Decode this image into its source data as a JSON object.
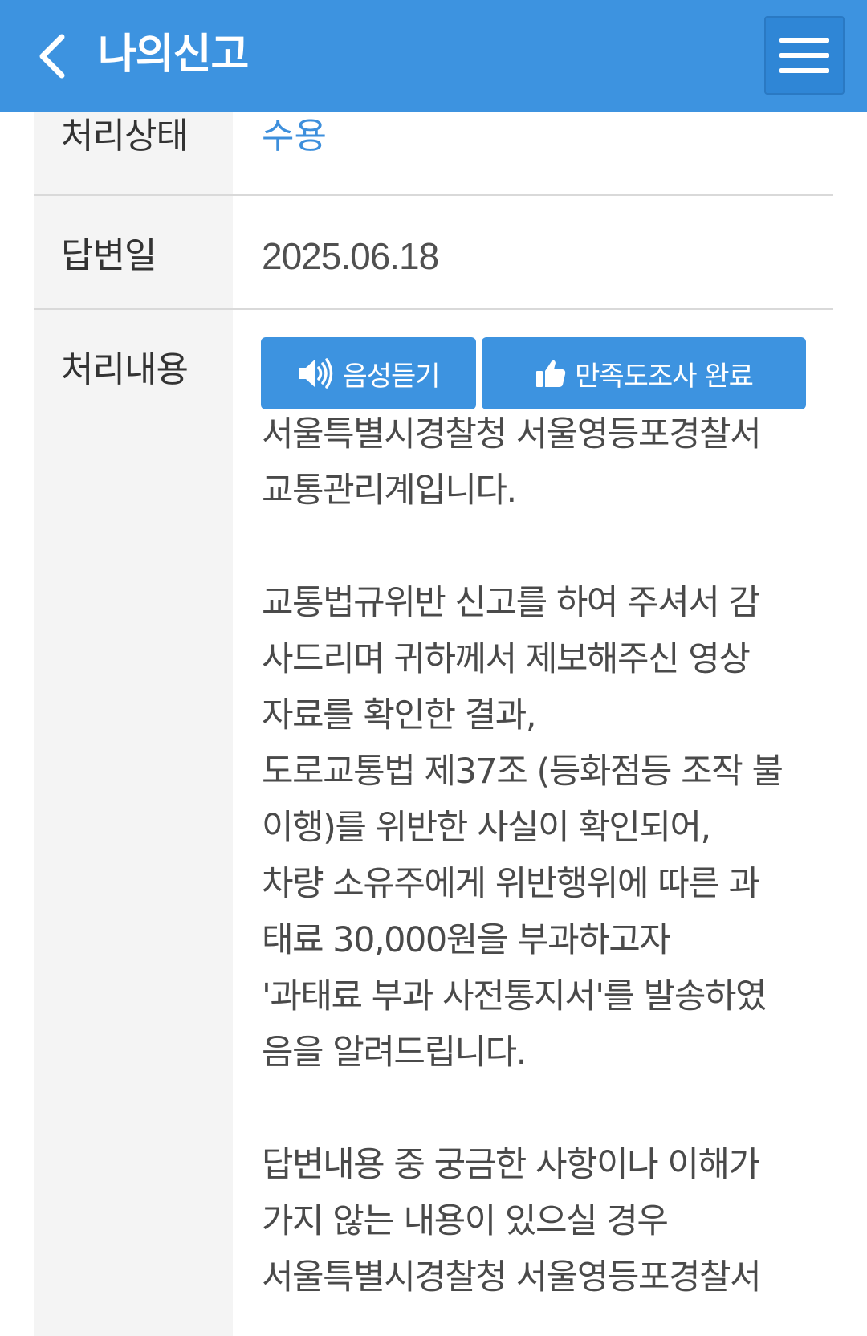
{
  "header": {
    "title": "나의신고",
    "back_icon": "chevron-left-icon",
    "menu_icon": "hamburger-menu-icon",
    "background_color": "#3d93e0"
  },
  "rows": {
    "status": {
      "label": "처리상태",
      "value": "수용",
      "value_color": "#3d8fdc"
    },
    "answer_date": {
      "label": "답변일",
      "value": "2025.06.18"
    },
    "content": {
      "label": "처리내용",
      "buttons": {
        "voice": {
          "label": "음성듣기",
          "icon": "speaker-icon"
        },
        "survey": {
          "label": "만족도조사 완료",
          "icon": "thumbs-up-icon"
        }
      },
      "lines": [
        "서울특별시경찰청 서울영등포경찰서",
        "교통관리계입니다.",
        "",
        "교통법규위반 신고를 하여 주셔서 감",
        "사드리며 귀하께서 제보해주신 영상",
        "자료를 확인한 결과,",
        "도로교통법 제37조 (등화점등 조작 불",
        "이행)를 위반한 사실이 확인되어,",
        "차량 소유주에게 위반행위에 따른 과",
        "태료 30,000원을 부과하고자",
        "'과태료 부과 사전통지서'를 발송하였",
        "음을 알려드립니다.",
        "",
        "답변내용 중 궁금한 사항이나 이해가",
        "가지 않는 내용이 있으실 경우",
        "서울특별시경찰청 서울영등포경찰서"
      ]
    }
  }
}
